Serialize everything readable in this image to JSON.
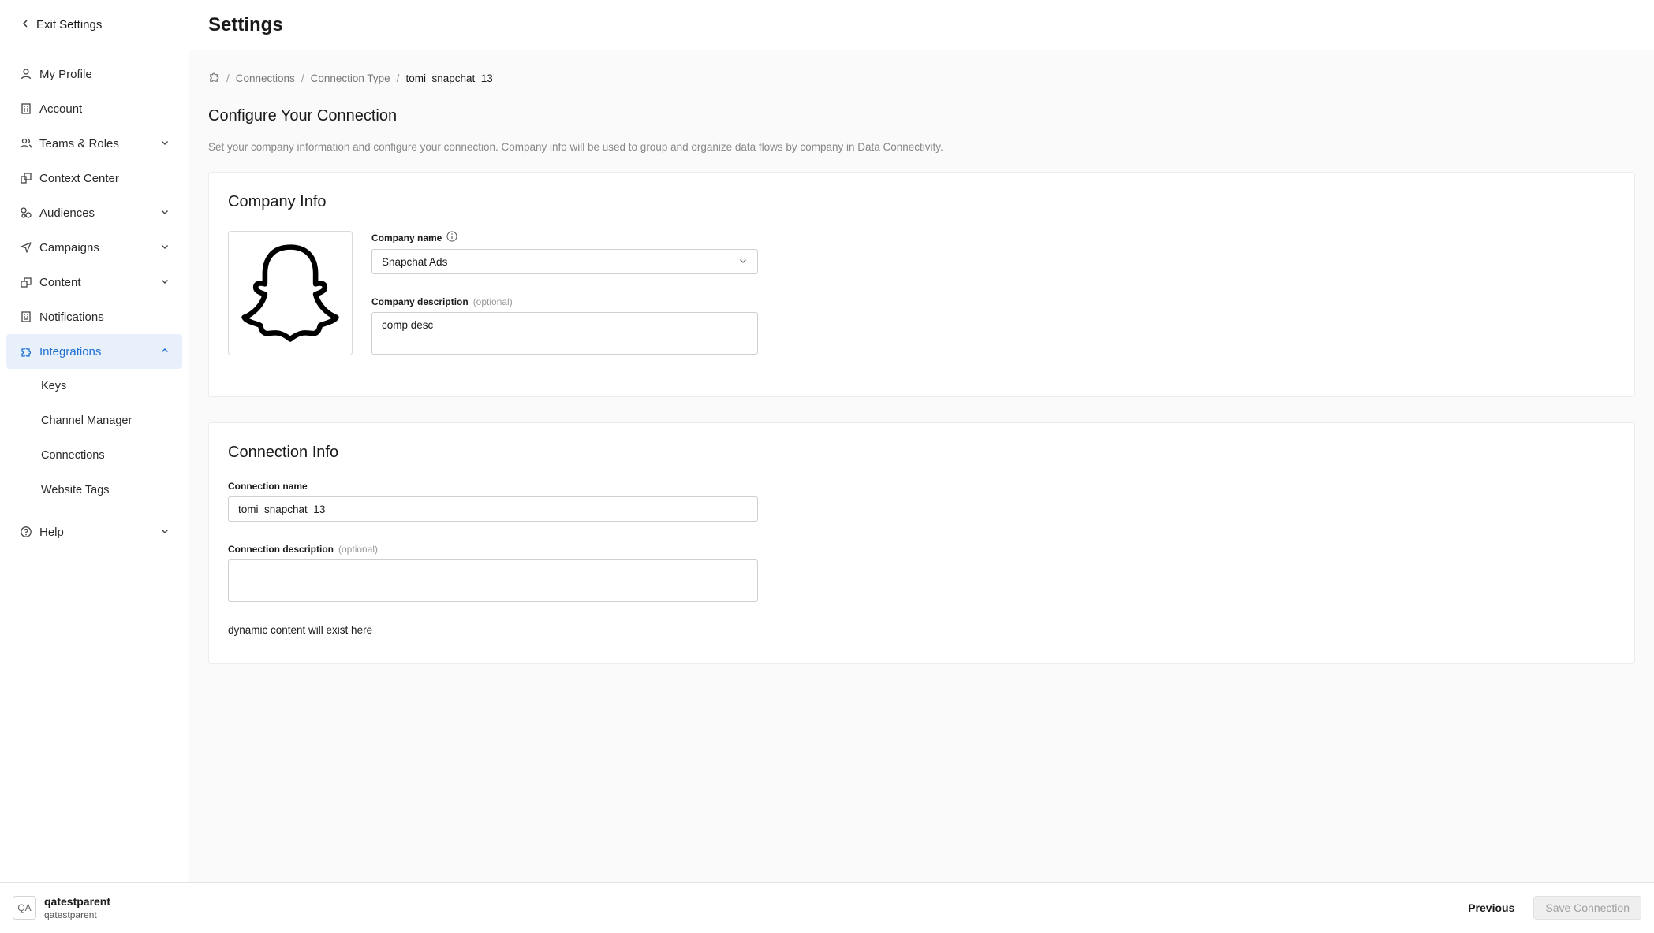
{
  "sidebar": {
    "exit_label": "Exit Settings",
    "items": [
      {
        "label": "My Profile"
      },
      {
        "label": "Account"
      },
      {
        "label": "Teams & Roles"
      },
      {
        "label": "Context Center"
      },
      {
        "label": "Audiences"
      },
      {
        "label": "Campaigns"
      },
      {
        "label": "Content"
      },
      {
        "label": "Notifications"
      },
      {
        "label": "Integrations"
      }
    ],
    "sub_items": [
      {
        "label": "Keys"
      },
      {
        "label": "Channel Manager"
      },
      {
        "label": "Connections"
      },
      {
        "label": "Website Tags"
      }
    ],
    "help_label": "Help",
    "user": {
      "initials": "QA",
      "name": "qatestparent",
      "org": "qatestparent"
    },
    "accent_color": "#1f6fd1"
  },
  "header": {
    "title": "Settings"
  },
  "breadcrumb": {
    "items": [
      "Connections",
      "Connection Type"
    ],
    "current": "tomi_snapchat_13"
  },
  "main": {
    "title": "Configure Your Connection",
    "description": "Set your company information and configure your connection. Company info will be used to group and organize data flows by company in Data Connectivity."
  },
  "company_info": {
    "heading": "Company Info",
    "name_label": "Company name",
    "name_value": "Snapchat Ads",
    "desc_label": "Company description",
    "desc_optional": "(optional)",
    "desc_value": "comp desc"
  },
  "connection_info": {
    "heading": "Connection Info",
    "name_label": "Connection name",
    "name_value": "tomi_snapchat_13",
    "desc_label": "Connection description",
    "desc_optional": "(optional)",
    "desc_value": "",
    "dynamic_note": "dynamic content will exist here"
  },
  "footer": {
    "previous_label": "Previous",
    "save_label": "Save Connection"
  }
}
